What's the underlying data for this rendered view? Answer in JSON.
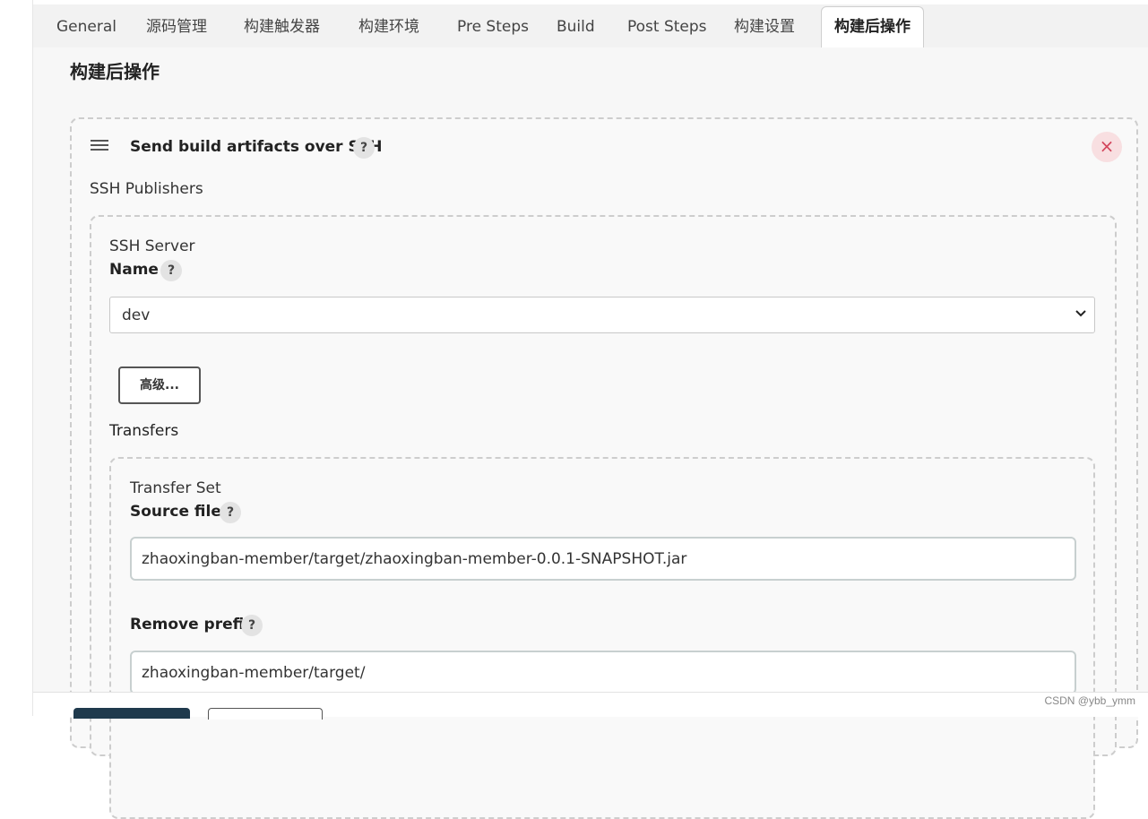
{
  "tabs": [
    {
      "label": "General"
    },
    {
      "label": "源码管理"
    },
    {
      "label": "构建触发器"
    },
    {
      "label": "构建环境"
    },
    {
      "label": "Pre Steps"
    },
    {
      "label": "Build"
    },
    {
      "label": "Post Steps"
    },
    {
      "label": "构建设置"
    },
    {
      "label": "构建后操作",
      "active": true
    }
  ],
  "section": {
    "title": "构建后操作"
  },
  "step": {
    "title": "Send build artifacts over SSH",
    "help": "?",
    "close": "×",
    "publishers_label": "SSH Publishers"
  },
  "ssh_server": {
    "group_label": "SSH Server",
    "name_label": "Name",
    "help": "?",
    "selected_value": "dev",
    "advanced_button": "高级..."
  },
  "transfers": {
    "label": "Transfers",
    "set_label": "Transfer Set",
    "source_files_label": "Source files",
    "source_files_value": "zhaoxingban-member/target/zhaoxingban-member-0.0.1-SNAPSHOT.jar",
    "remove_prefix_label": "Remove prefix",
    "remove_prefix_value": "zhaoxingban-member/target/",
    "help": "?"
  },
  "watermark": "CSDN @ybb_ymm",
  "colors": {
    "close_bg": "#f8dfe1",
    "close_fg": "#d3455b",
    "save_button": "#1f3a4d"
  }
}
